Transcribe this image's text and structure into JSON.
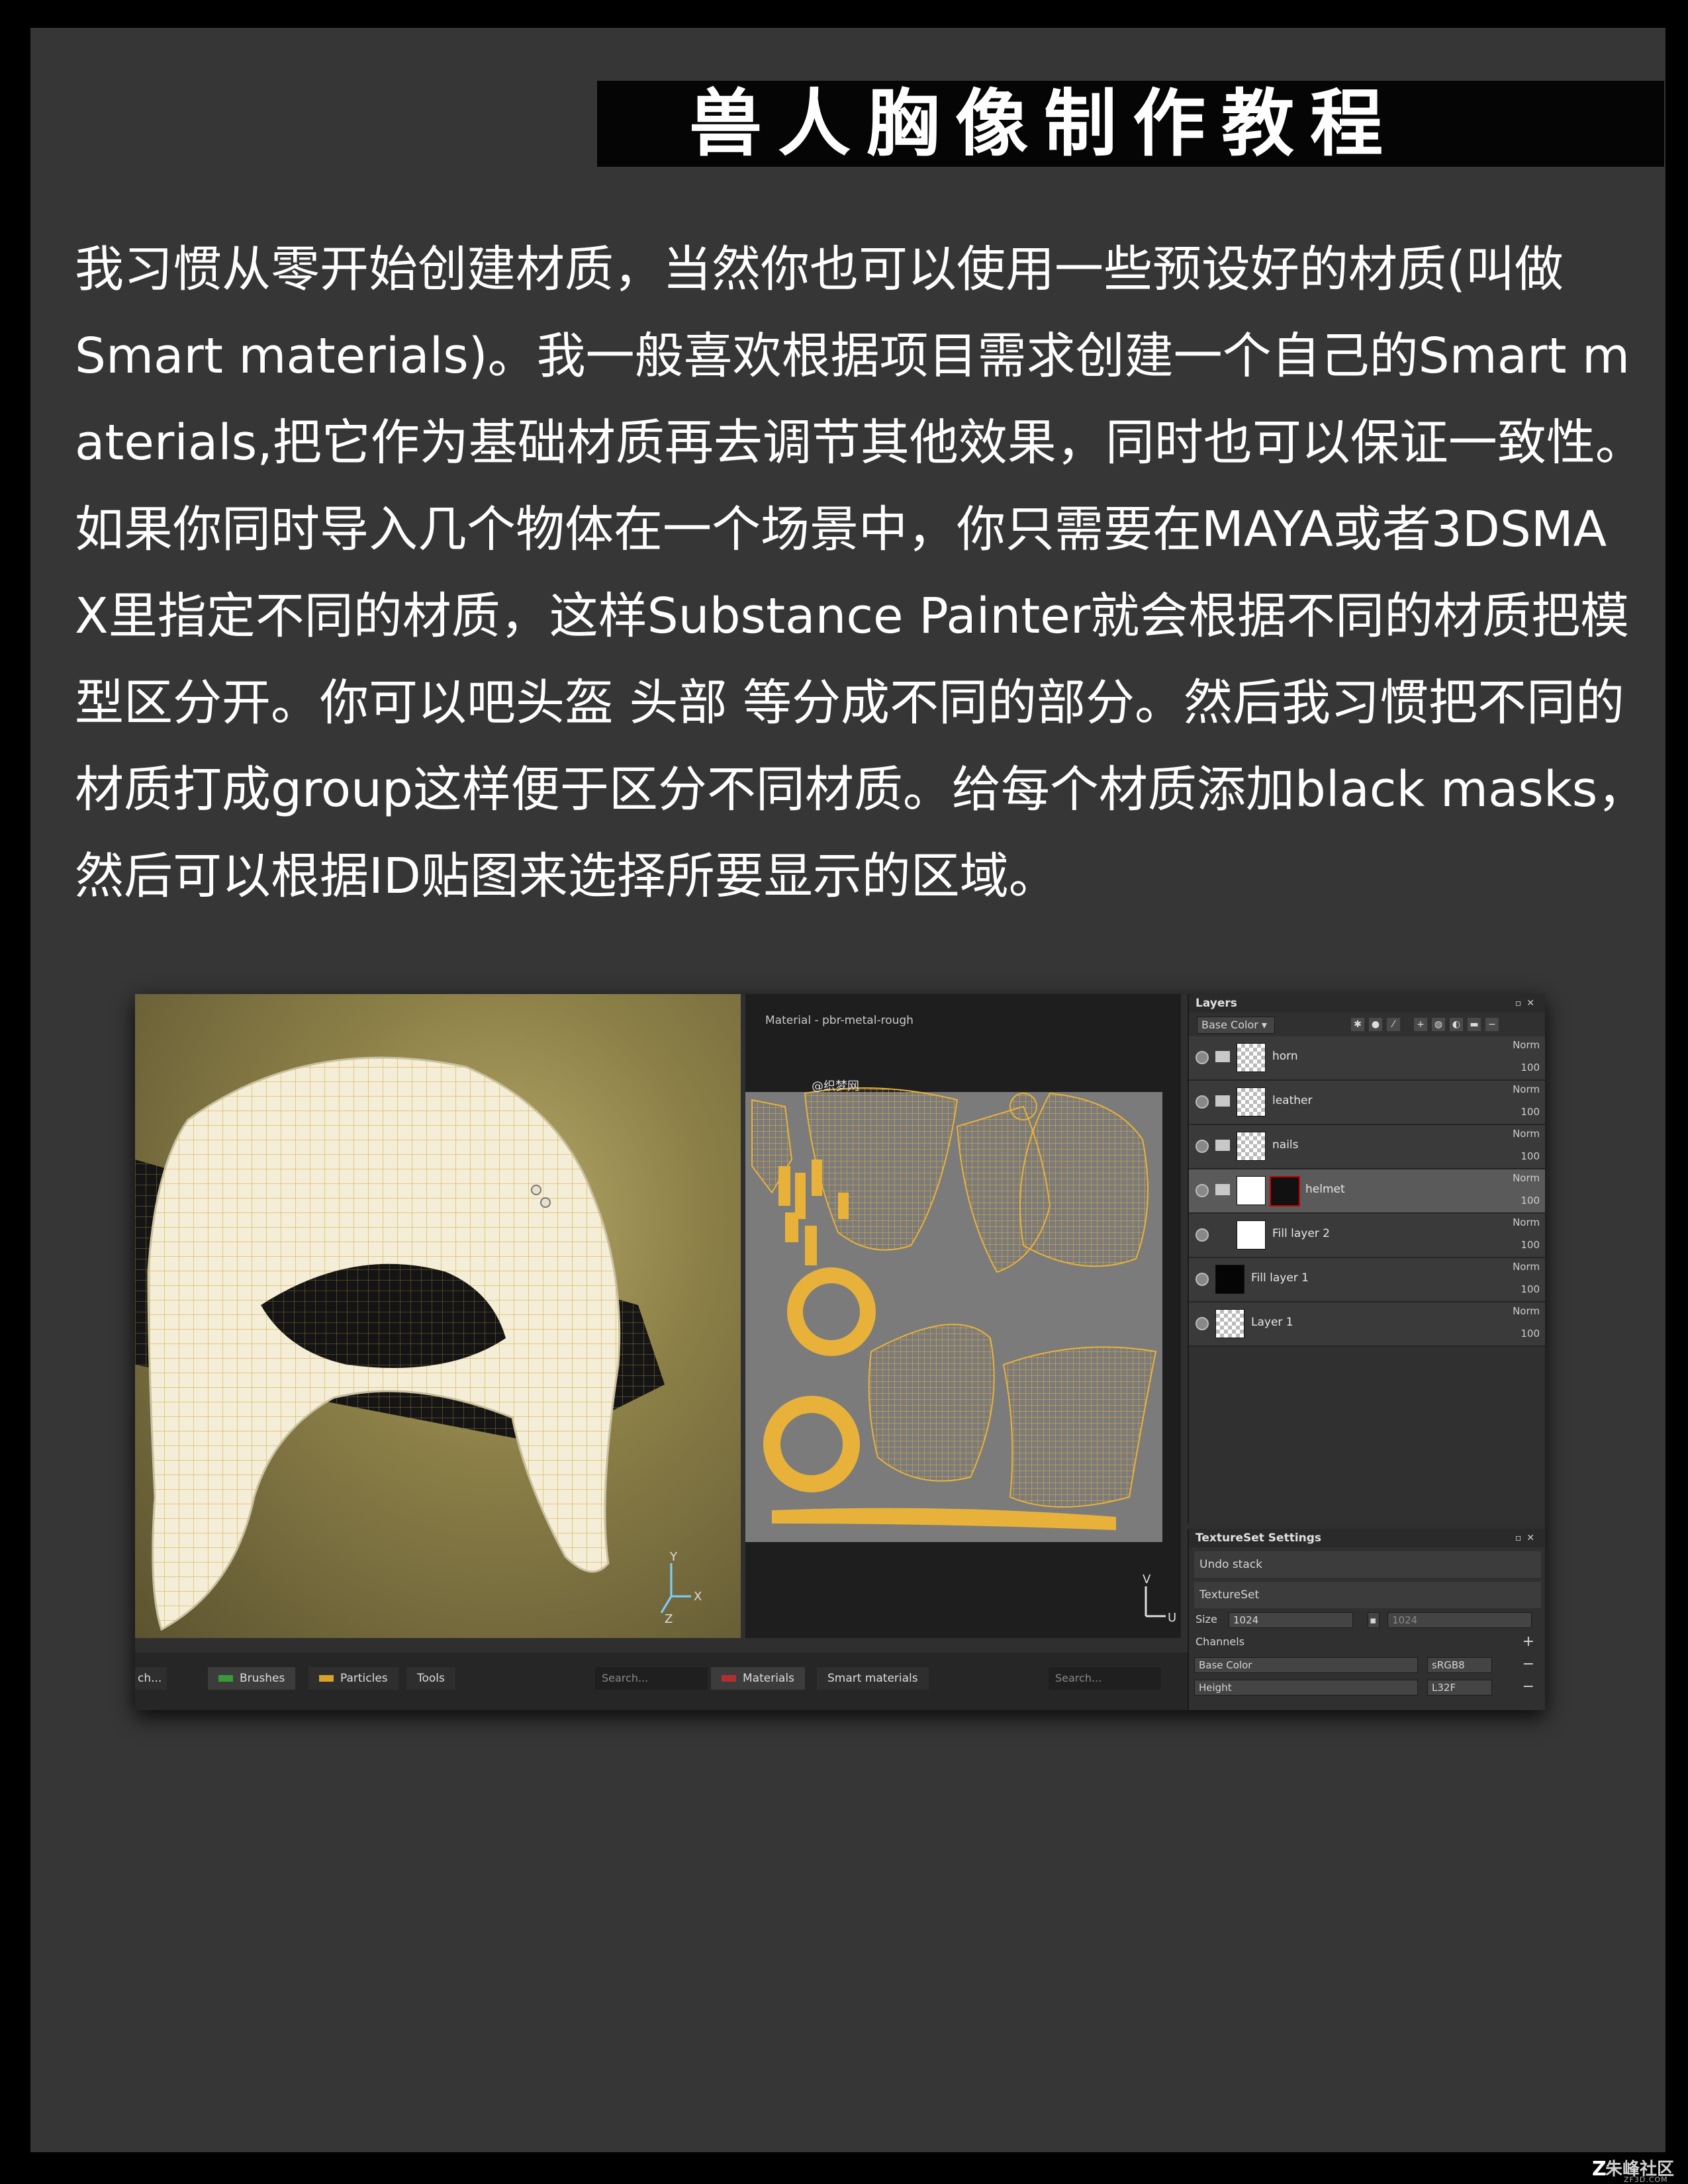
{
  "title": "兽人胸像制作教程",
  "body_lines": [
    "我习惯从零开始创建材质，当然你也可以使用一些预设好的材质(叫做",
    "Smart materials)。我一般喜欢根据项目需求创建一个自己的Smart m",
    "aterials,把它作为基础材质再去调节其他效果，同时也可以保证一致性。",
    "如果你同时导入几个物体在一个场景中，你只需要在MAYA或者3DSMA",
    "X里指定不同的材质，这样Substance Painter就会根据不同的材质把模",
    "型区分开。你可以吧头盔 头部 等分成不同的部分。然后我习惯把不同的",
    "材质打成group这样便于区分不同材质。给每个材质添加black masks，",
    "然后可以根据ID贴图来选择所要显示的区域。"
  ],
  "screenshot": {
    "viewport2d_label": "Material - pbr-metal-rough",
    "viewport2d_watermark": "@织梦网",
    "axis_3d": {
      "y": "Y",
      "z": "Z",
      "x": "X"
    },
    "axis_2d": {
      "v": "V",
      "u": "U"
    },
    "layers_panel": {
      "title": "Layers",
      "channel_dropdown": "Base Color",
      "layers": [
        {
          "name": "horn",
          "blend": "Norm",
          "opacity": "100",
          "folder": true,
          "thumb": "checker",
          "selected": false
        },
        {
          "name": "leather",
          "blend": "Norm",
          "opacity": "100",
          "folder": true,
          "thumb": "checker",
          "selected": false
        },
        {
          "name": "nails",
          "blend": "Norm",
          "opacity": "100",
          "folder": true,
          "thumb": "checker",
          "selected": false
        },
        {
          "name": "helmet",
          "blend": "Norm",
          "opacity": "100",
          "folder": true,
          "thumb": "white",
          "selected": true
        },
        {
          "name": "Fill layer 2",
          "blend": "Norm",
          "opacity": "100",
          "folder": false,
          "thumb": "white",
          "selected": false
        },
        {
          "name": "Fill layer 1",
          "blend": "Norm",
          "opacity": "100",
          "folder": false,
          "thumb": "black",
          "selected": false
        },
        {
          "name": "Layer 1",
          "blend": "Norm",
          "opacity": "100",
          "folder": false,
          "thumb": "checker",
          "selected": false
        }
      ]
    },
    "textureset_panel": {
      "title": "TextureSet Settings",
      "undo_stack": "Undo stack",
      "textureset": "TextureSet",
      "size_label": "Size",
      "size_value": "1024",
      "size_value2": "1024",
      "channels_label": "Channels",
      "channels": [
        {
          "name": "Base Color",
          "format": "sRGB8"
        },
        {
          "name": "Height",
          "format": "L32F"
        }
      ]
    },
    "shelf": {
      "left_search_stub": "ch...",
      "tabs_left": [
        "Brushes",
        "Particles",
        "Tools"
      ],
      "search_left": "Search...",
      "tabs_right": [
        "Materials",
        "Smart materials"
      ],
      "search_right": "Search..."
    },
    "colors": {
      "uv_wire": "#e8b23a",
      "helmet": "#f2ead0",
      "selected_row": "#5a5a5a"
    }
  },
  "watermark": {
    "text": "朱峰社区",
    "sub": "ZF3D.COM",
    "logo": "Z"
  }
}
